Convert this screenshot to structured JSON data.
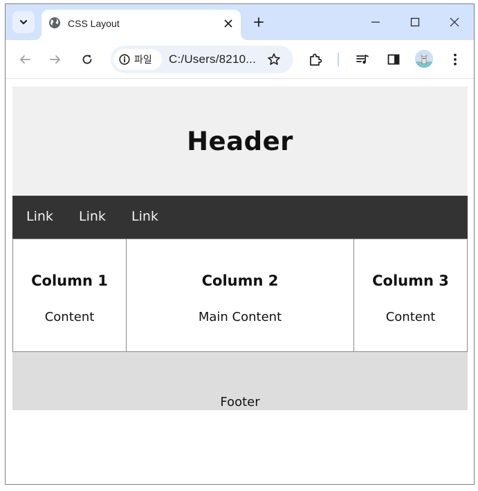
{
  "browser": {
    "tab": {
      "title": "CSS Layout",
      "favicon": "globe-icon"
    },
    "omnibox": {
      "site_chip_label": "파일",
      "url": "C:/Users/8210..."
    },
    "colors": {
      "tabstrip": "#d3e3fd",
      "omnibox": "#edf2fa"
    }
  },
  "page": {
    "header": {
      "title": "Header"
    },
    "nav": {
      "links": [
        "Link",
        "Link",
        "Link"
      ]
    },
    "columns": [
      {
        "title": "Column 1",
        "content": "Content"
      },
      {
        "title": "Column 2",
        "content": "Main Content"
      },
      {
        "title": "Column 3",
        "content": "Content"
      }
    ],
    "footer": {
      "text": "Footer"
    },
    "colors": {
      "header_bg": "#f0f0f0",
      "nav_bg": "#333333",
      "footer_bg": "#dddddd"
    }
  }
}
